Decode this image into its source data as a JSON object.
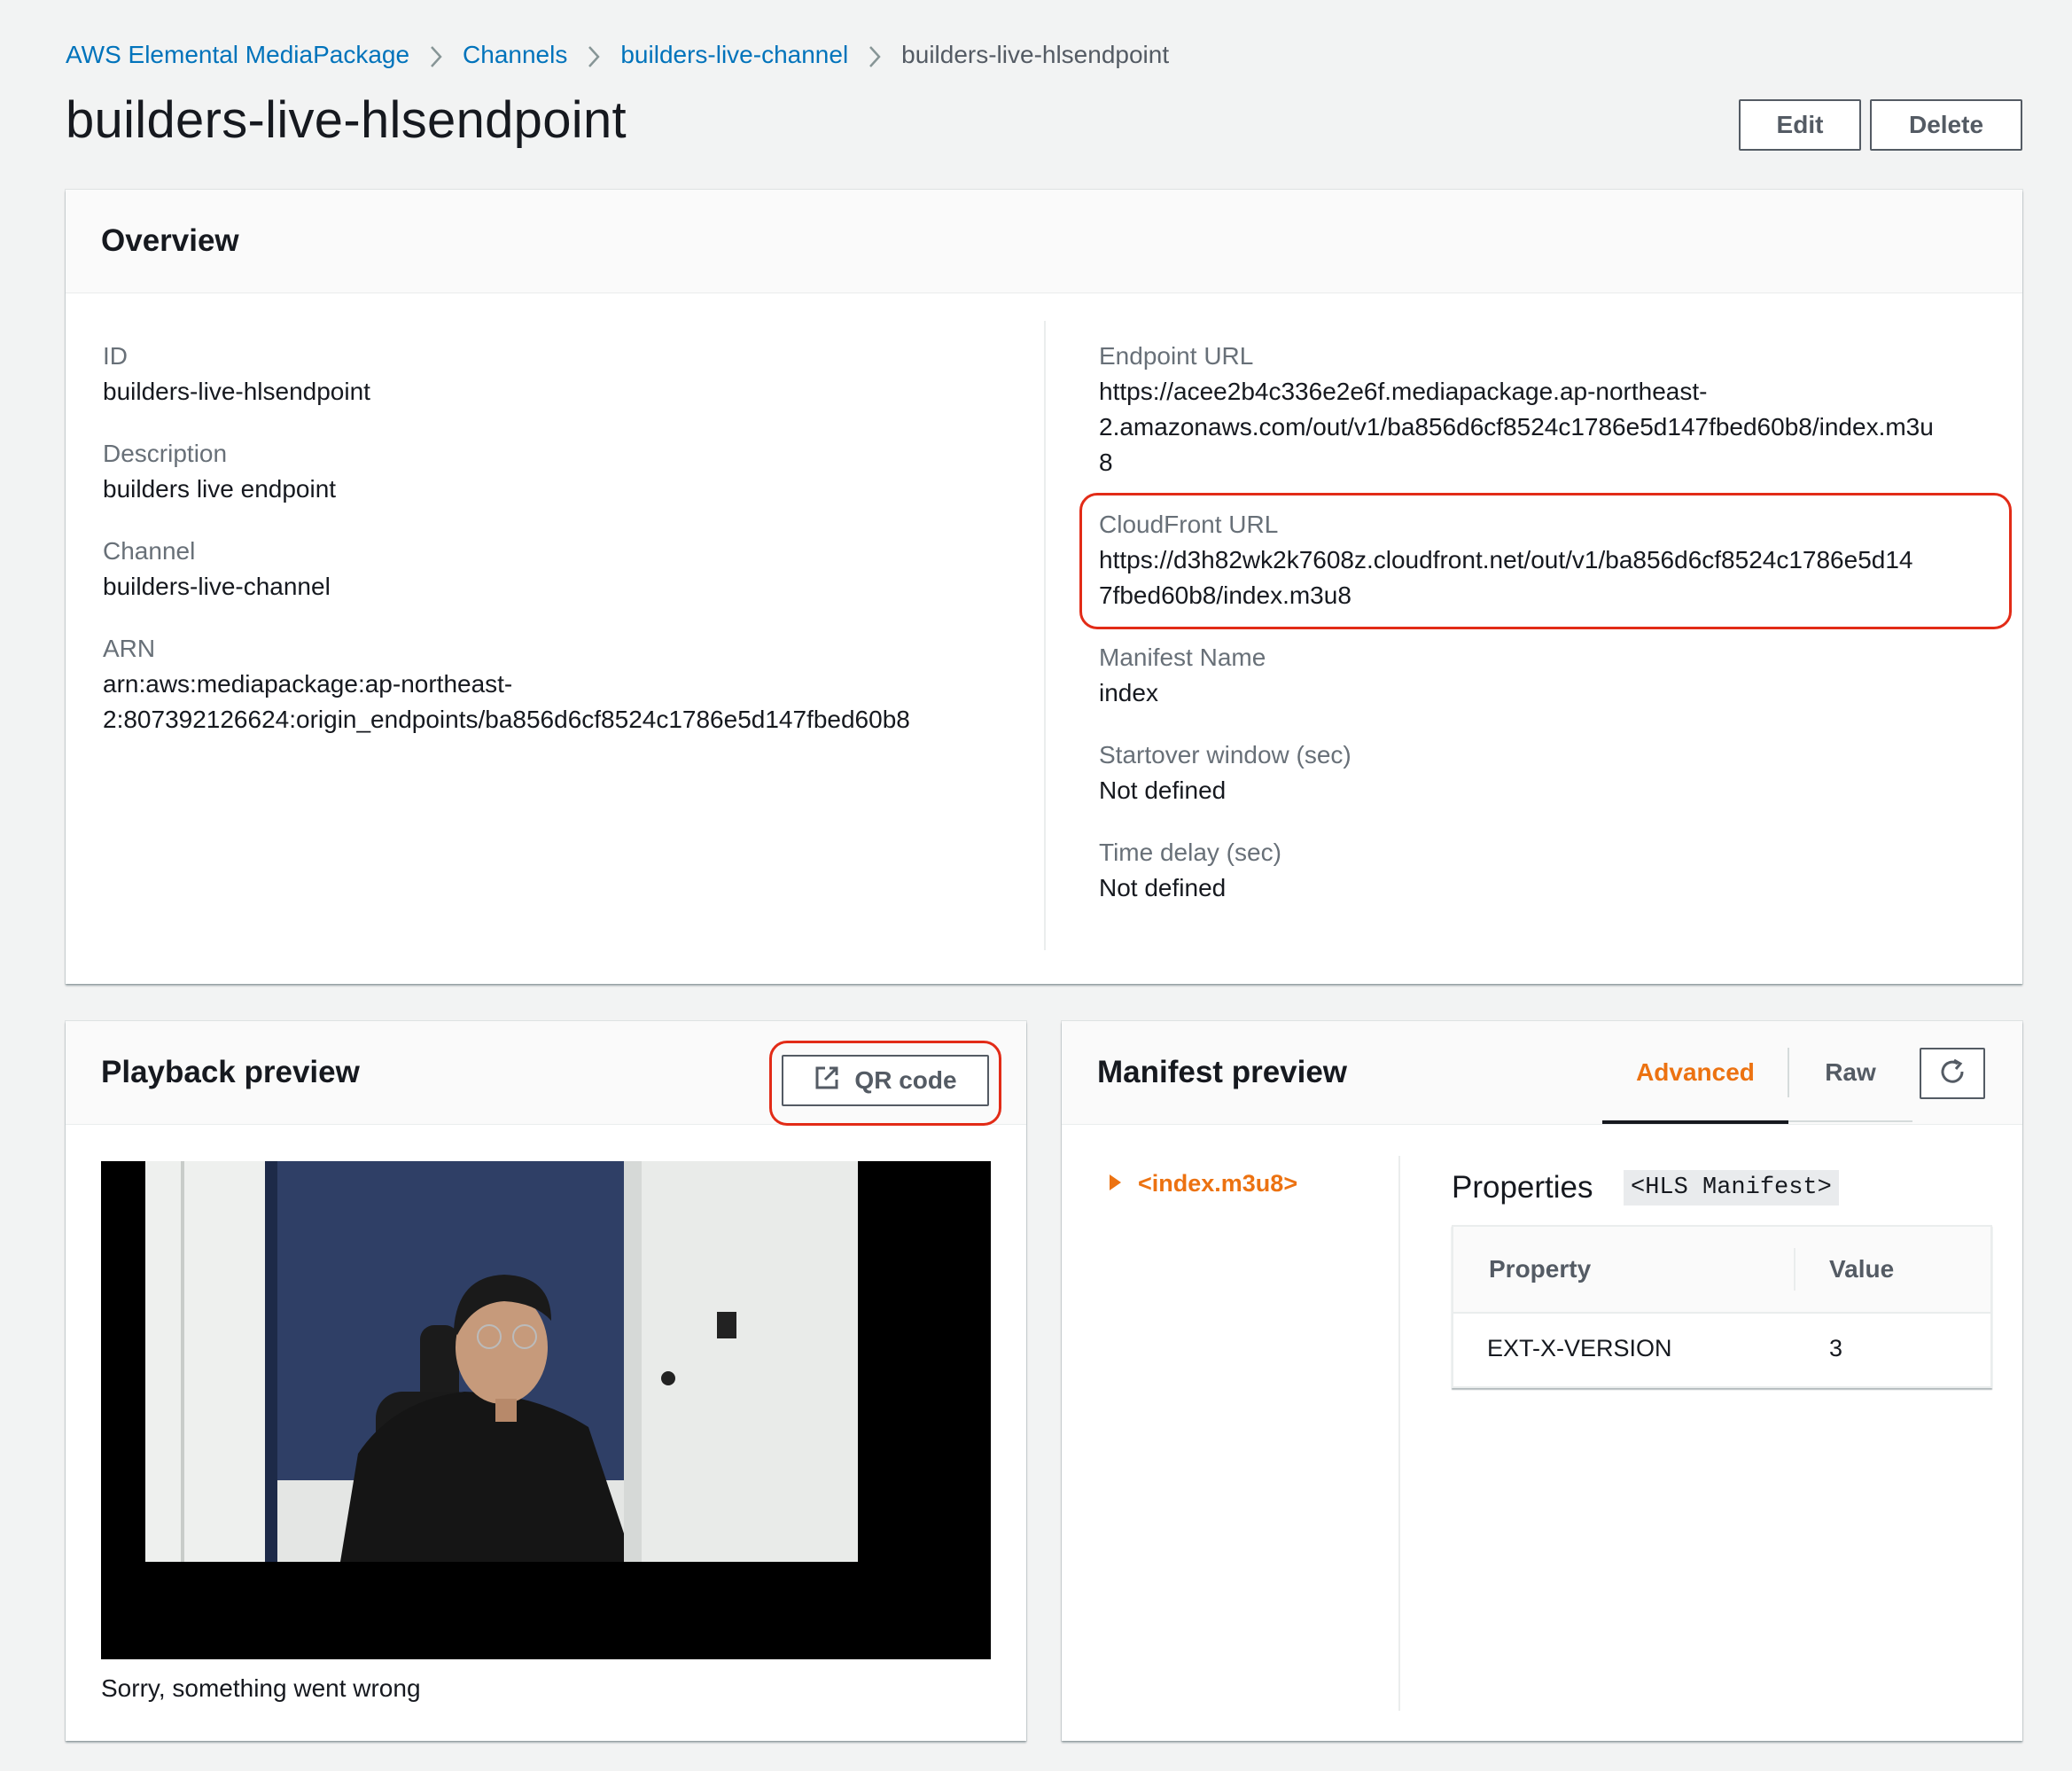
{
  "breadcrumb": {
    "items": [
      {
        "label": "AWS Elemental MediaPackage"
      },
      {
        "label": "Channels"
      },
      {
        "label": "builders-live-channel"
      }
    ],
    "current": "builders-live-hlsendpoint"
  },
  "page": {
    "title": "builders-live-hlsendpoint",
    "edit_label": "Edit",
    "delete_label": "Delete"
  },
  "overview": {
    "title": "Overview",
    "left": {
      "id_label": "ID",
      "id_value": "builders-live-hlsendpoint",
      "description_label": "Description",
      "description_value": "builders live endpoint",
      "channel_label": "Channel",
      "channel_value": "builders-live-channel",
      "arn_label": "ARN",
      "arn_line1": "arn:aws:mediapackage:ap-northeast-",
      "arn_line2": "2:807392126624:origin_endpoints/ba856d6cf8524c1786e5d147fbed60b8"
    },
    "right": {
      "endpoint_label": "Endpoint URL",
      "endpoint_line1": "https://acee2b4c336e2e6f.mediapackage.ap-northeast-",
      "endpoint_line2": "2.amazonaws.com/out/v1/ba856d6cf8524c1786e5d147fbed60b8/index.m3u",
      "endpoint_line3": "8",
      "cloudfront_label": "CloudFront URL",
      "cloudfront_line1": "https://d3h82wk2k7608z.cloudfront.net/out/v1/ba856d6cf8524c1786e5d14",
      "cloudfront_line2": "7fbed60b8/index.m3u8",
      "manifest_name_label": "Manifest Name",
      "manifest_name_value": "index",
      "startover_label": "Startover window (sec)",
      "startover_value": "Not defined",
      "time_delay_label": "Time delay (sec)",
      "time_delay_value": "Not defined"
    }
  },
  "playback": {
    "title": "Playback preview",
    "qr_label": "QR code",
    "qr_icon": "external-link-icon",
    "error": "Sorry, something went wrong"
  },
  "manifest": {
    "title": "Manifest preview",
    "tabs": [
      {
        "label": "Advanced",
        "active": true
      },
      {
        "label": "Raw",
        "active": false
      }
    ],
    "refresh_icon": "refresh-icon",
    "tree_item": "<index.m3u8>",
    "properties_label": "Properties",
    "properties_tag": "<HLS Manifest>",
    "table": {
      "headers": [
        "Property",
        "Value"
      ],
      "rows": [
        {
          "property": "EXT-X-VERSION",
          "value": "3"
        }
      ]
    }
  },
  "colors": {
    "link": "#0073bb",
    "accent_orange": "#ec7211",
    "highlight_red": "#e22b17",
    "background": "#f2f3f3"
  }
}
